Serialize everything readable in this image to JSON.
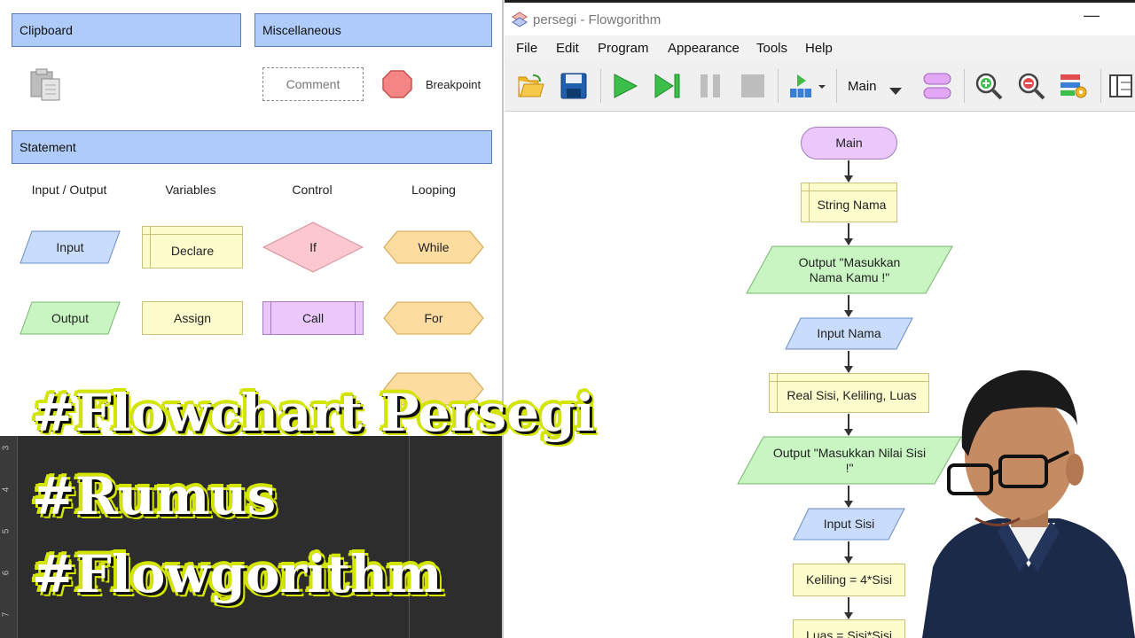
{
  "palette": {
    "clipboard_header": "Clipboard",
    "misc_header": "Miscellaneous",
    "comment_label": "Comment",
    "breakpoint_label": "Breakpoint",
    "statement_header": "Statement",
    "categories": [
      "Input / Output",
      "Variables",
      "Control",
      "Looping"
    ],
    "items": {
      "input": "Input",
      "declare": "Declare",
      "if": "If",
      "while": "While",
      "output": "Output",
      "assign": "Assign",
      "call": "Call",
      "for": "For"
    }
  },
  "window": {
    "title": "persegi - Flowgorithm",
    "minimize": "—",
    "menu": [
      "File",
      "Edit",
      "Program",
      "Appearance",
      "Tools",
      "Help"
    ],
    "function_selector": "Main",
    "icons": [
      "open-folder-icon",
      "save-icon",
      "run-icon",
      "step-icon",
      "pause-icon",
      "stop-icon",
      "run-options-icon",
      "function-shape-icon",
      "zoom-in-icon",
      "zoom-out-icon",
      "layout-settings-icon",
      "panel-icon"
    ]
  },
  "flowchart": {
    "main": "Main",
    "declare_nama": "String Nama",
    "output_nama": "Output \"Masukkan Nama Kamu !\"",
    "input_nama": "Input Nama",
    "declare_sisi": "Real Sisi, Keliling, Luas",
    "output_sisi": "Output \"Masukkan Nilai Sisi !\"",
    "input_sisi": "Input Sisi",
    "assign_keliling": "Keliling = 4*Sisi",
    "assign_luas": "Luas = Sisi*Sisi"
  },
  "ruler": [
    "3",
    "4",
    "5",
    "6",
    "7"
  ],
  "overlay": {
    "line1": "#Flowchart Persegi",
    "line2": "#Rumus",
    "line3": "#Flowgorithm"
  },
  "colors": {
    "header_blue": "#aecbfa",
    "io_blue": "#c9dcfb",
    "output_green": "#c8f5c2",
    "declare_yellow": "#fdfccd",
    "if_pink": "#fac8ce",
    "loop_orange": "#fddca0",
    "call_purple": "#eac8fb",
    "overlay_outline": "#d4e600"
  }
}
